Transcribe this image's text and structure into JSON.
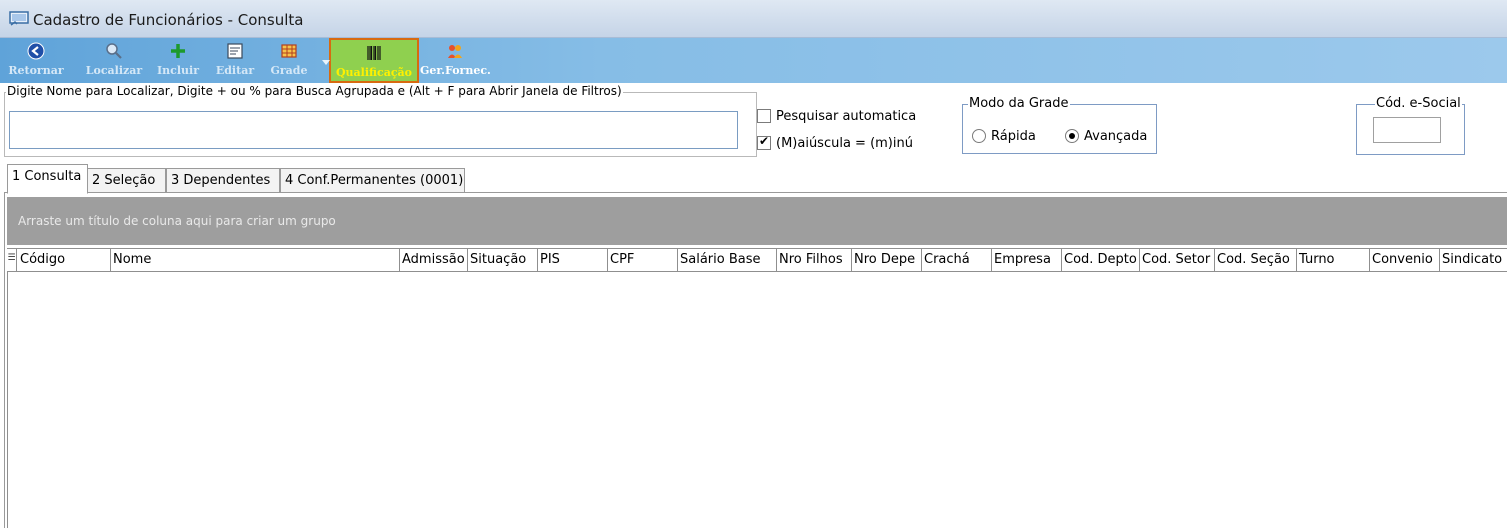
{
  "window": {
    "title": "Cadastro de Funcionários - Consulta"
  },
  "toolbar": {
    "retornar": "Retornar",
    "localizar": "Localizar",
    "incluir": "Incluir",
    "editar": "Editar",
    "grade": "Grade",
    "qualificacao": "Qualificação",
    "ger_fornec": "Ger.Fornec."
  },
  "search": {
    "legend": "Digite Nome para Localizar, Digite + ou % para Busca Agrupada e (Alt + F para Abrir Janela de Filtros)",
    "value": "",
    "pesquisar_automatica": {
      "label": "Pesquisar automatica",
      "checked": false
    },
    "maiuscula": {
      "label": "(M)aiúscula = (m)inú",
      "checked": true
    }
  },
  "modo_grade": {
    "legend": "Modo da Grade",
    "options": [
      {
        "label": "Rápida",
        "selected": false
      },
      {
        "label": "Avançada",
        "selected": true
      }
    ]
  },
  "esocial": {
    "legend": "Cód. e-Social",
    "value": ""
  },
  "tabs": [
    {
      "label": "1 Consulta",
      "active": true
    },
    {
      "label": "2 Seleção",
      "active": false
    },
    {
      "label": "3 Dependentes",
      "active": false
    },
    {
      "label": "4 Conf.Permanentes (0001)",
      "active": false
    }
  ],
  "grid": {
    "group_hint": "Arraste um título de coluna aqui para criar um grupo",
    "columns": [
      "Código",
      "Nome",
      "Admissão",
      "Situação",
      "PIS",
      "CPF",
      "Salário Base",
      "Nro Filhos",
      "Nro Depe",
      "Crachá",
      "Empresa",
      "Cod. Depto",
      "Cod. Setor",
      "Cod. Seção",
      "Turno",
      "Convenio",
      "Sindicato"
    ]
  },
  "colors": {
    "toolbar": "#86bde6",
    "active_button": "#8fd04f",
    "active_border": "#d86a10",
    "group_panel": "#9e9e9e"
  }
}
